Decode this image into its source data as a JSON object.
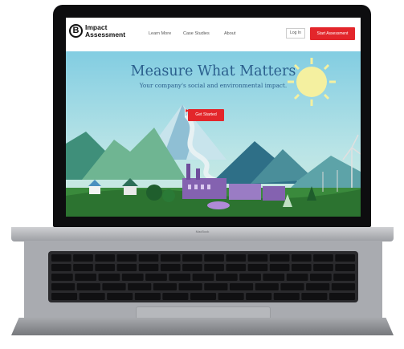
{
  "nav": {
    "logo_line1": "Impact",
    "logo_line2": "Assessment",
    "logo_mark": "B",
    "links": [
      "Learn More",
      "Case Studies",
      "About"
    ],
    "login_label": "Log In",
    "start_label": "Start Assessment"
  },
  "hero": {
    "headline": "Measure What Matters",
    "subhead": "Your company's social and environmental impact.",
    "cta_label": "Get Started"
  },
  "device": {
    "label": "MacBook"
  },
  "colors": {
    "accent_red": "#e3262b",
    "headline_blue": "#2b5f8d",
    "sky": "#82cde2"
  }
}
